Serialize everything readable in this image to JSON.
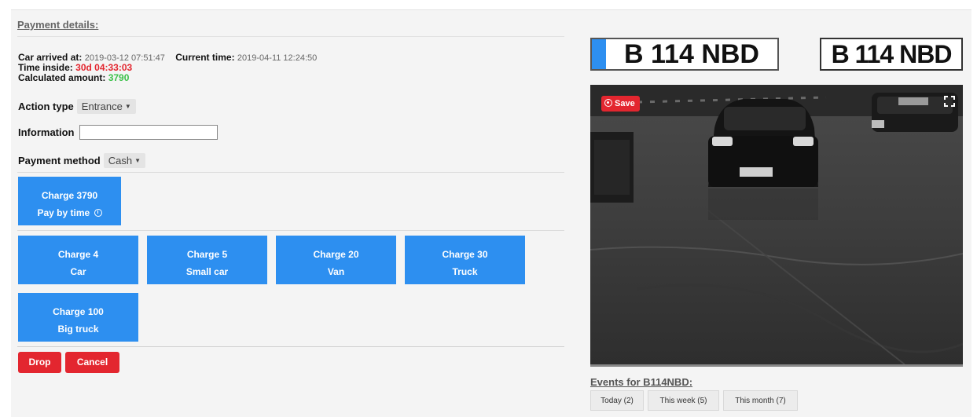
{
  "panel": {
    "title": "Payment details:"
  },
  "info": {
    "arrived_label": "Car arrived at:",
    "arrived_value": "2019-03-12 07:51:47",
    "current_label": "Current time:",
    "current_value": "2019-04-11 12:24:50",
    "time_inside_label": "Time inside:",
    "time_inside_value": "30d 04:33:03",
    "amount_label": "Calculated amount:",
    "amount_value": "3790"
  },
  "form": {
    "action_type_label": "Action type",
    "action_type_value": "Entrance",
    "information_label": "Information",
    "information_value": "",
    "payment_method_label": "Payment method",
    "payment_method_value": "Cash"
  },
  "pay_by_time": {
    "line1": "Charge 3790",
    "line2": "Pay by time"
  },
  "charges": [
    {
      "line1": "Charge 4",
      "line2": "Car"
    },
    {
      "line1": "Charge 5",
      "line2": "Small car"
    },
    {
      "line1": "Charge 20",
      "line2": "Van"
    },
    {
      "line1": "Charge 30",
      "line2": "Truck"
    },
    {
      "line1": "Charge 100",
      "line2": "Big truck"
    }
  ],
  "actions": {
    "drop": "Drop",
    "cancel": "Cancel"
  },
  "plates": {
    "recognized": "B 114 NBD",
    "rendered": "B 114 NBD"
  },
  "camera": {
    "save_label": "Save",
    "car_plate_in_image": "B114NBD"
  },
  "events": {
    "title": "Events for B114NBD:",
    "buttons": [
      "Today (2)",
      "This week (5)",
      "This month (7)"
    ]
  },
  "colors": {
    "accent_blue": "#2d8ff0",
    "danger_red": "#e3262f",
    "amount_green": "#3cc14a",
    "panel_bg": "#f4f4f4"
  },
  "icons": {
    "pay_by_time": "clock-icon",
    "save": "record-icon",
    "camera_corner": "fullscreen-icon",
    "select": "caret-down-icon"
  }
}
